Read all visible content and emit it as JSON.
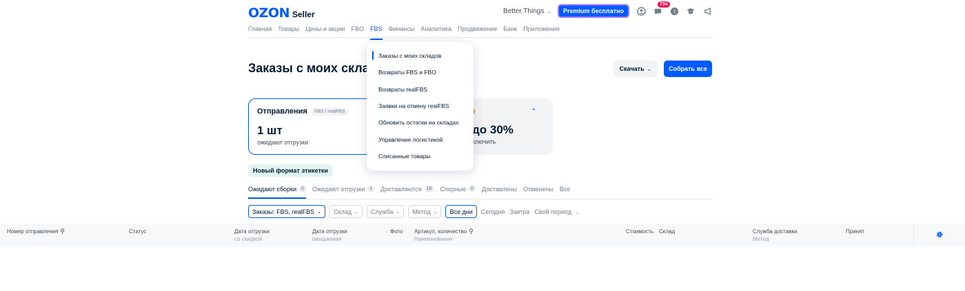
{
  "header": {
    "logo_mark": "OZON",
    "logo_text": "Seller",
    "store_name": "Better Things",
    "premium_label": "Premium бесплатно",
    "chat_badge": "734"
  },
  "nav": {
    "items": [
      "Главная",
      "Товары",
      "Цены и акции",
      "FBO",
      "FBS",
      "Финансы",
      "Аналитика",
      "Продвижение",
      "Банк",
      "Приложения"
    ],
    "active": "FBS"
  },
  "page": {
    "title": "Заказы с моих скла",
    "download_label": "Скачать",
    "collect_label": "Собрать все"
  },
  "card_shipments": {
    "title": "Отправления",
    "tag": "FBS / realFBS",
    "value": "1 шт",
    "subtitle": "ожидают отгрузки"
  },
  "card_promo": {
    "value": "до 30%",
    "subtitle": "ключить"
  },
  "label_chip": "Новый формат этикетки",
  "tabs": [
    {
      "label": "Ожидают сборки",
      "count": "0"
    },
    {
      "label": "Ожидают отгрузки",
      "count": "1"
    },
    {
      "label": "Доставляются",
      "count": "18"
    },
    {
      "label": "Спорные",
      "count": "0"
    },
    {
      "label": "Доставлены",
      "count": ""
    },
    {
      "label": "Отменены",
      "count": ""
    },
    {
      "label": "Все",
      "count": ""
    }
  ],
  "filters": {
    "scheme": "Заказы: FBS, realFBS",
    "warehouse": "Склад",
    "service": "Служба",
    "method": "Метод",
    "all_days": "Все дни",
    "today": "Сегодня",
    "tomorrow": "Завтра",
    "custom": "Свой период"
  },
  "table": {
    "col_number": "Номер отправления",
    "col_status": "Статус",
    "col_ship_date": "Дата отгрузки",
    "col_ship_date_sub": "со скидкой",
    "col_ship_expected": "Дата отгрузки",
    "col_ship_expected_sub": "ожидаемая",
    "col_photo": "Фото",
    "col_article": "Артикул, количество",
    "col_article_sub": "Наименование",
    "col_price": "Стоимость",
    "col_warehouse": "Склад",
    "col_delivery": "Служба доставки",
    "col_delivery_sub": "Метод",
    "col_accepted": "Принят"
  },
  "fbs_menu": {
    "items": [
      "Заказы с моих складов",
      "Возвраты FBS и FBO",
      "Возвраты realFBS",
      "Заявки на отмену realFBS",
      "Обновить остатки на складах",
      "Управление логистикой",
      "Списанные товары"
    ]
  },
  "colors": {
    "accent": "#005bff",
    "badge": "#f91155",
    "promo_dot": "#ff8c00"
  }
}
